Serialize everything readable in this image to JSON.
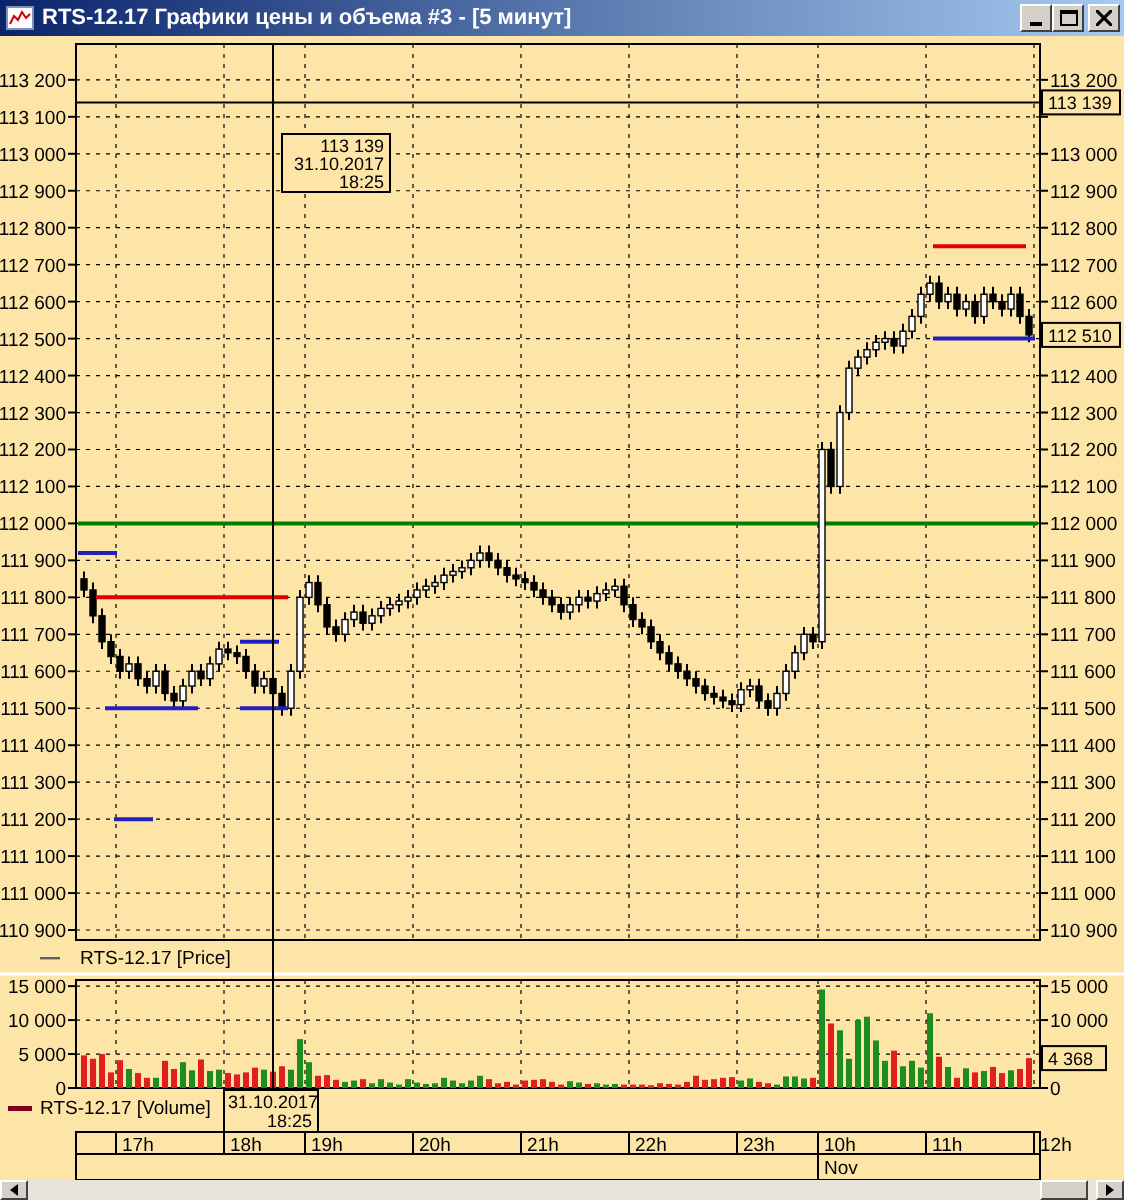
{
  "window": {
    "title": "RTS-12.17 Графики цены и объема #3 - [5 минут]"
  },
  "price_panel": {
    "legend": {
      "label": "RTS-12.17 [Price]",
      "color": "#606060"
    },
    "last_price_label": "112 510",
    "crosshair_price_label": "113 139",
    "crosshair_tooltip": {
      "price": "113 139",
      "date": "31.10.2017",
      "time": "18:25"
    },
    "chart_data": {
      "type": "candlestick",
      "grid": true,
      "ylim": [
        110873,
        113297
      ],
      "yticks": [
        {
          "value": 113200,
          "label": "113 200"
        },
        {
          "value": 113100,
          "label": "113 100"
        },
        {
          "value": 113000,
          "label": "113 000"
        },
        {
          "value": 112900,
          "label": "112 900"
        },
        {
          "value": 112800,
          "label": "112 800"
        },
        {
          "value": 112700,
          "label": "112 700"
        },
        {
          "value": 112600,
          "label": "112 600"
        },
        {
          "value": 112500,
          "label": "112 500"
        },
        {
          "value": 112400,
          "label": "112 400"
        },
        {
          "value": 112300,
          "label": "112 300"
        },
        {
          "value": 112200,
          "label": "112 200"
        },
        {
          "value": 112100,
          "label": "112 100"
        },
        {
          "value": 112000,
          "label": "112 000"
        },
        {
          "value": 111900,
          "label": "111 900"
        },
        {
          "value": 111800,
          "label": "111 800"
        },
        {
          "value": 111700,
          "label": "111 700"
        },
        {
          "value": 111600,
          "label": "111 600"
        },
        {
          "value": 111500,
          "label": "111 500"
        },
        {
          "value": 111400,
          "label": "111 400"
        },
        {
          "value": 111300,
          "label": "111 300"
        },
        {
          "value": 111200,
          "label": "111 200"
        },
        {
          "value": 111100,
          "label": "111 100"
        },
        {
          "value": 111000,
          "label": "111 000"
        },
        {
          "value": 110900,
          "label": "110 900"
        }
      ],
      "ohlc": [
        [
          111850,
          111870,
          111800,
          111820
        ],
        [
          111820,
          111840,
          111730,
          111750
        ],
        [
          111750,
          111770,
          111660,
          111680
        ],
        [
          111680,
          111700,
          111620,
          111640
        ],
        [
          111640,
          111660,
          111580,
          111600
        ],
        [
          111600,
          111640,
          111580,
          111620
        ],
        [
          111620,
          111640,
          111560,
          111580
        ],
        [
          111580,
          111600,
          111540,
          111560
        ],
        [
          111560,
          111620,
          111540,
          111600
        ],
        [
          111600,
          111620,
          111520,
          111540
        ],
        [
          111540,
          111560,
          111500,
          111520
        ],
        [
          111520,
          111580,
          111500,
          111560
        ],
        [
          111560,
          111620,
          111540,
          111600
        ],
        [
          111600,
          111620,
          111560,
          111580
        ],
        [
          111580,
          111640,
          111560,
          111620
        ],
        [
          111620,
          111680,
          111600,
          111660
        ],
        [
          111660,
          111680,
          111630,
          111650
        ],
        [
          111650,
          111670,
          111620,
          111640
        ],
        [
          111640,
          111660,
          111580,
          111600
        ],
        [
          111600,
          111620,
          111540,
          111560
        ],
        [
          111560,
          111600,
          111540,
          111580
        ],
        [
          111580,
          111600,
          111520,
          111540
        ],
        [
          111540,
          111560,
          111480,
          111500
        ],
        [
          111500,
          111620,
          111480,
          111600
        ],
        [
          111600,
          111820,
          111580,
          111800
        ],
        [
          111800,
          111860,
          111780,
          111840
        ],
        [
          111840,
          111860,
          111760,
          111780
        ],
        [
          111780,
          111800,
          111700,
          111720
        ],
        [
          111720,
          111740,
          111680,
          111700
        ],
        [
          111700,
          111760,
          111680,
          111740
        ],
        [
          111740,
          111780,
          111720,
          111760
        ],
        [
          111760,
          111780,
          111710,
          111730
        ],
        [
          111730,
          111770,
          111710,
          111750
        ],
        [
          111750,
          111790,
          111730,
          111770
        ],
        [
          111770,
          111800,
          111750,
          111780
        ],
        [
          111780,
          111810,
          111760,
          111790
        ],
        [
          111790,
          111820,
          111770,
          111800
        ],
        [
          111800,
          111840,
          111780,
          111820
        ],
        [
          111820,
          111850,
          111800,
          111830
        ],
        [
          111830,
          111860,
          111810,
          111840
        ],
        [
          111840,
          111880,
          111820,
          111860
        ],
        [
          111860,
          111890,
          111840,
          111870
        ],
        [
          111870,
          111900,
          111850,
          111880
        ],
        [
          111880,
          111920,
          111860,
          111900
        ],
        [
          111900,
          111940,
          111880,
          111920
        ],
        [
          111920,
          111940,
          111880,
          111900
        ],
        [
          111900,
          111920,
          111860,
          111880
        ],
        [
          111880,
          111900,
          111840,
          111860
        ],
        [
          111860,
          111880,
          111830,
          111850
        ],
        [
          111850,
          111870,
          111820,
          111840
        ],
        [
          111840,
          111860,
          111800,
          111820
        ],
        [
          111820,
          111840,
          111780,
          111800
        ],
        [
          111800,
          111820,
          111760,
          111780
        ],
        [
          111780,
          111800,
          111740,
          111760
        ],
        [
          111760,
          111800,
          111740,
          111780
        ],
        [
          111780,
          111820,
          111760,
          111800
        ],
        [
          111800,
          111820,
          111770,
          111790
        ],
        [
          111790,
          111830,
          111770,
          111810
        ],
        [
          111810,
          111840,
          111790,
          111820
        ],
        [
          111820,
          111850,
          111800,
          111830
        ],
        [
          111830,
          111850,
          111760,
          111780
        ],
        [
          111780,
          111800,
          111720,
          111740
        ],
        [
          111740,
          111760,
          111700,
          111720
        ],
        [
          111720,
          111740,
          111660,
          111680
        ],
        [
          111680,
          111700,
          111630,
          111650
        ],
        [
          111650,
          111670,
          111600,
          111620
        ],
        [
          111620,
          111640,
          111580,
          111600
        ],
        [
          111600,
          111620,
          111560,
          111580
        ],
        [
          111580,
          111600,
          111540,
          111560
        ],
        [
          111560,
          111580,
          111520,
          111540
        ],
        [
          111540,
          111560,
          111510,
          111530
        ],
        [
          111530,
          111550,
          111500,
          111520
        ],
        [
          111520,
          111540,
          111490,
          111510
        ],
        [
          111510,
          111570,
          111490,
          111550
        ],
        [
          111550,
          111580,
          111530,
          111560
        ],
        [
          111560,
          111580,
          111500,
          111520
        ],
        [
          111520,
          111540,
          111480,
          111500
        ],
        [
          111500,
          111560,
          111480,
          111540
        ],
        [
          111540,
          111620,
          111520,
          111600
        ],
        [
          111600,
          111670,
          111580,
          111650
        ],
        [
          111650,
          111720,
          111630,
          111700
        ],
        [
          111700,
          111720,
          111660,
          111680
        ],
        [
          111680,
          112220,
          111660,
          112200
        ],
        [
          112200,
          112220,
          112080,
          112100
        ],
        [
          112100,
          112320,
          112080,
          112300
        ],
        [
          112300,
          112440,
          112280,
          112420
        ],
        [
          112420,
          112470,
          112400,
          112450
        ],
        [
          112450,
          112490,
          112430,
          112470
        ],
        [
          112470,
          112510,
          112450,
          112490
        ],
        [
          112490,
          112520,
          112470,
          112500
        ],
        [
          112500,
          112520,
          112460,
          112480
        ],
        [
          112480,
          112540,
          112460,
          112520
        ],
        [
          112520,
          112580,
          112500,
          112560
        ],
        [
          112560,
          112640,
          112540,
          112620
        ],
        [
          112620,
          112670,
          112600,
          112650
        ],
        [
          112650,
          112670,
          112580,
          112600
        ],
        [
          112600,
          112640,
          112580,
          112620
        ],
        [
          112620,
          112640,
          112560,
          112580
        ],
        [
          112580,
          112620,
          112560,
          112600
        ],
        [
          112600,
          112620,
          112540,
          112560
        ],
        [
          112560,
          112640,
          112540,
          112620
        ],
        [
          112620,
          112640,
          112580,
          112600
        ],
        [
          112600,
          112620,
          112560,
          112580
        ],
        [
          112580,
          112640,
          112560,
          112620
        ],
        [
          112620,
          112640,
          112540,
          112560
        ],
        [
          112560,
          112580,
          112490,
          112510
        ]
      ],
      "ref_lines": [
        {
          "axis": "y",
          "value": 112000,
          "color": "#008000"
        },
        {
          "axis": "y",
          "value": 113139,
          "color": "#000000"
        }
      ]
    }
  },
  "volume_panel": {
    "legend": {
      "label": "RTS-12.17 [Volume]",
      "color": "#800020"
    },
    "last_volume_label": "4 368",
    "crosshair_date": "31.10.2017",
    "crosshair_time": "18:25",
    "chart_data": {
      "type": "bar",
      "grid": true,
      "ylim": [
        0,
        15900
      ],
      "yticks": [
        {
          "value": 15000,
          "label": "15 000"
        },
        {
          "value": 10000,
          "label": "10 000"
        },
        {
          "value": 5000,
          "label": "5 000"
        },
        {
          "value": 0,
          "label": "0"
        }
      ],
      "series": [
        {
          "color": "#1e8c1e",
          "values": [
            null,
            null,
            null,
            null,
            null,
            2800,
            null,
            null,
            1500,
            null,
            null,
            3800,
            2600,
            null,
            2500,
            2700,
            null,
            null,
            null,
            null,
            2700,
            null,
            null,
            2700,
            7200,
            3800,
            null,
            null,
            null,
            900,
            1100,
            null,
            700,
            1300,
            800,
            500,
            1300,
            800,
            600,
            700,
            1500,
            1100,
            700,
            1100,
            1800,
            null,
            null,
            null,
            null,
            null,
            null,
            null,
            null,
            null,
            1000,
            800,
            null,
            700,
            500,
            600,
            null,
            null,
            null,
            null,
            null,
            null,
            null,
            null,
            null,
            null,
            null,
            null,
            null,
            1100,
            1400,
            null,
            null,
            500,
            1700,
            1700,
            1400,
            null,
            14500,
            null,
            8500,
            4300,
            10000,
            10500,
            7000,
            4000,
            null,
            3200,
            4000,
            3000,
            11000,
            null,
            3100,
            null,
            2900,
            null,
            2500,
            null,
            null,
            2600,
            null,
            null
          ]
        },
        {
          "color": "#e02020",
          "values": [
            4800,
            4300,
            5000,
            2300,
            4100,
            null,
            2200,
            1500,
            null,
            4000,
            2800,
            null,
            null,
            4200,
            null,
            null,
            2200,
            2000,
            2300,
            3000,
            null,
            2400,
            3200,
            null,
            null,
            null,
            1800,
            1900,
            1200,
            null,
            null,
            1300,
            null,
            null,
            null,
            null,
            null,
            null,
            null,
            null,
            null,
            null,
            null,
            null,
            null,
            1300,
            700,
            900,
            500,
            1100,
            1200,
            1300,
            900,
            500,
            null,
            null,
            600,
            null,
            null,
            null,
            500,
            500,
            500,
            400,
            700,
            600,
            500,
            900,
            1800,
            1200,
            1300,
            1500,
            1600,
            null,
            null,
            900,
            700,
            null,
            null,
            null,
            null,
            1500,
            null,
            9500,
            null,
            null,
            null,
            null,
            null,
            null,
            5500,
            null,
            null,
            null,
            null,
            4600,
            null,
            1500,
            null,
            2300,
            null,
            3100,
            2200,
            null,
            2800,
            4400
          ]
        }
      ]
    }
  },
  "time_axis": {
    "hours": [
      "17h",
      "18h",
      "19h",
      "20h",
      "21h",
      "22h",
      "23h",
      "10h",
      "11h",
      "12h"
    ],
    "dates": [
      "Nov"
    ]
  }
}
